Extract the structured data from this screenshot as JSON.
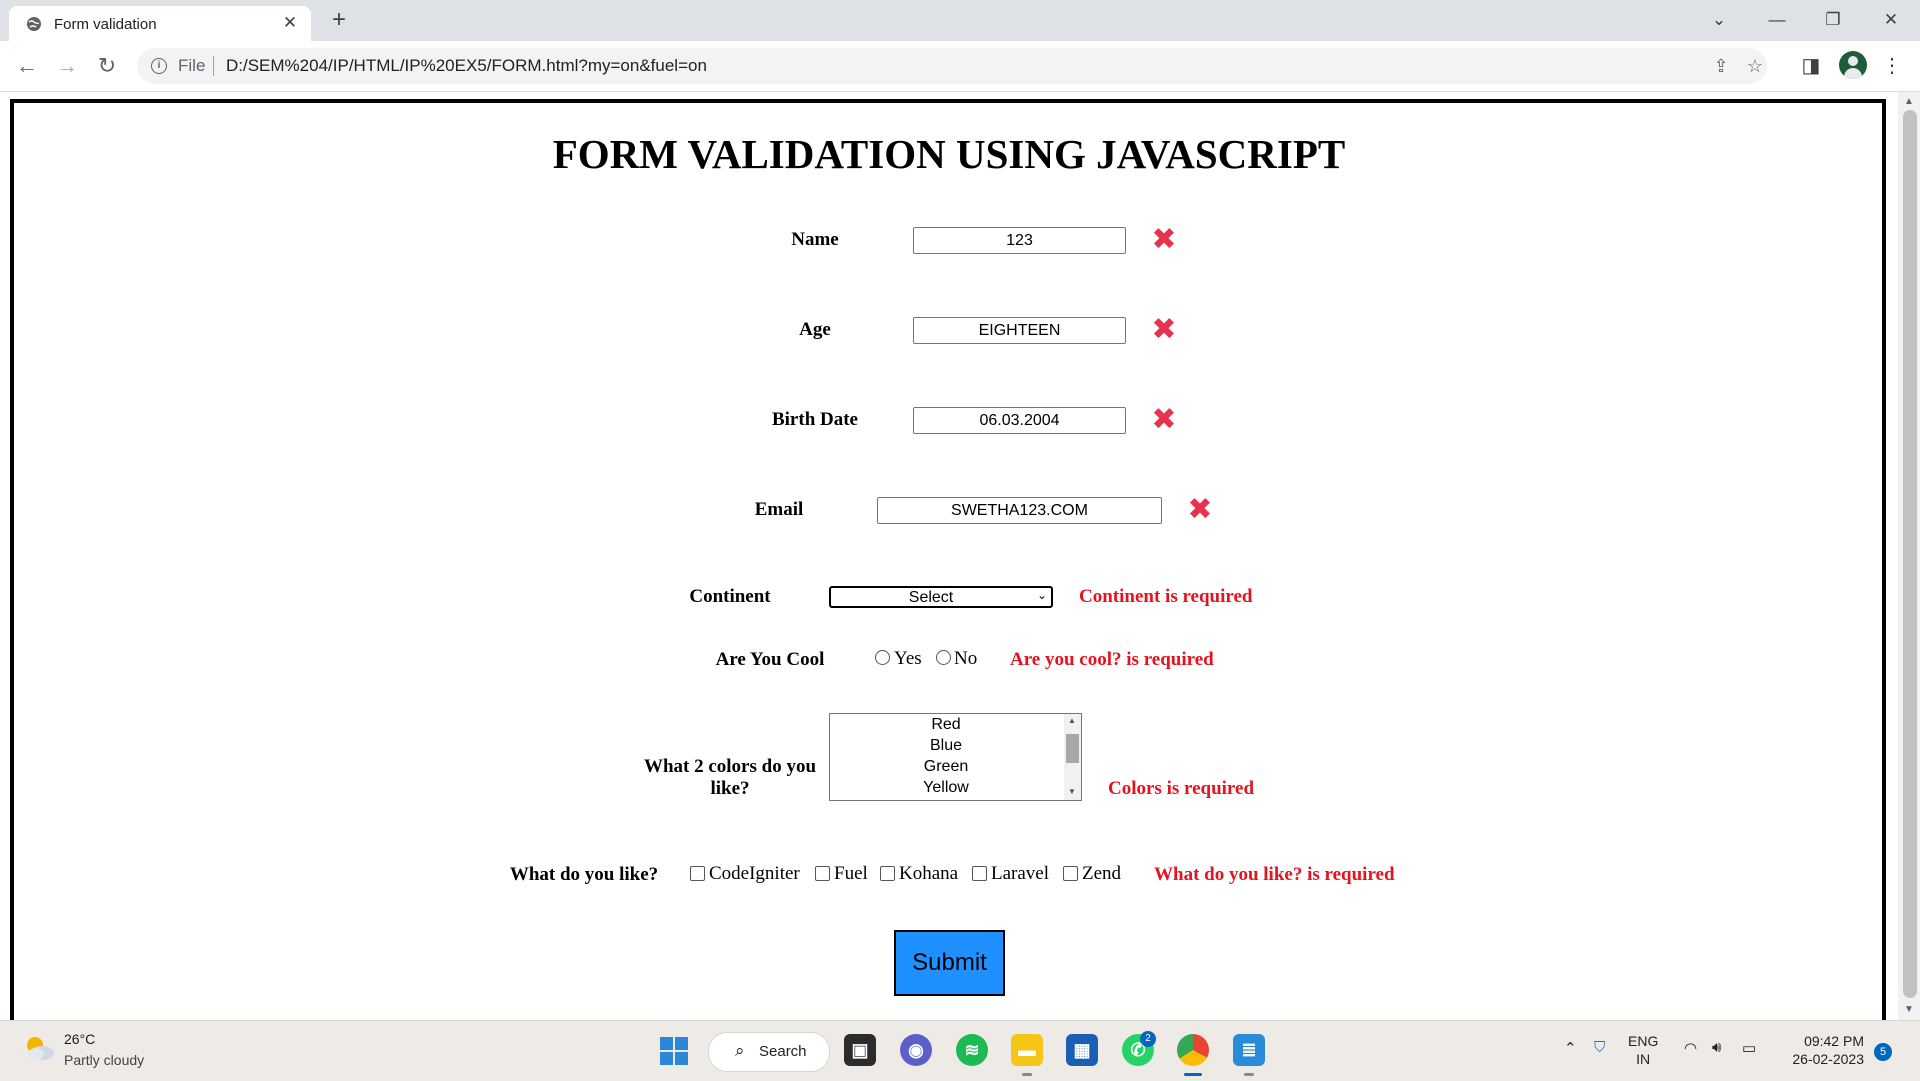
{
  "browser": {
    "tab_title": "Form validation",
    "tab_close": "✕",
    "new_tab": "+",
    "file_label": "File",
    "url": "D:/SEM%204/IP/HTML/IP%20EX5/FORM.html?my=on&fuel=on"
  },
  "page": {
    "heading": "FORM VALIDATION USING JAVASCRIPT",
    "fields": {
      "name": {
        "label": "Name",
        "value": "123"
      },
      "age": {
        "label": "Age",
        "value": "EIGHTEEN"
      },
      "birth_date": {
        "label": "Birth Date",
        "value": "06.03.2004"
      },
      "email": {
        "label": "Email",
        "value": "SWETHA123.COM"
      }
    },
    "invalid_mark": "✖",
    "continent": {
      "label": "Continent",
      "selected": "Select",
      "error": "Continent is required"
    },
    "cool": {
      "label": "Are You Cool",
      "options": [
        "Yes",
        "No"
      ],
      "error": "Are you cool? is required"
    },
    "colors": {
      "label": "What 2 colors do you like?",
      "options": [
        "Red",
        "Blue",
        "Green",
        "Yellow"
      ],
      "error": "Colors is required"
    },
    "likes": {
      "label": "What do you like?",
      "options": [
        "CodeIgniter",
        "Fuel",
        "Kohana",
        "Laravel",
        "Zend"
      ],
      "error": "What do you like? is required"
    },
    "submit_label": "Submit"
  },
  "taskbar": {
    "weather_temp": "26°C",
    "weather_desc": "Partly cloudy",
    "search_label": "Search",
    "whatsapp_badge": "2",
    "lang_line1": "ENG",
    "lang_line2": "IN",
    "time": "09:42 PM",
    "date": "26-02-2023",
    "notifications": "5"
  }
}
